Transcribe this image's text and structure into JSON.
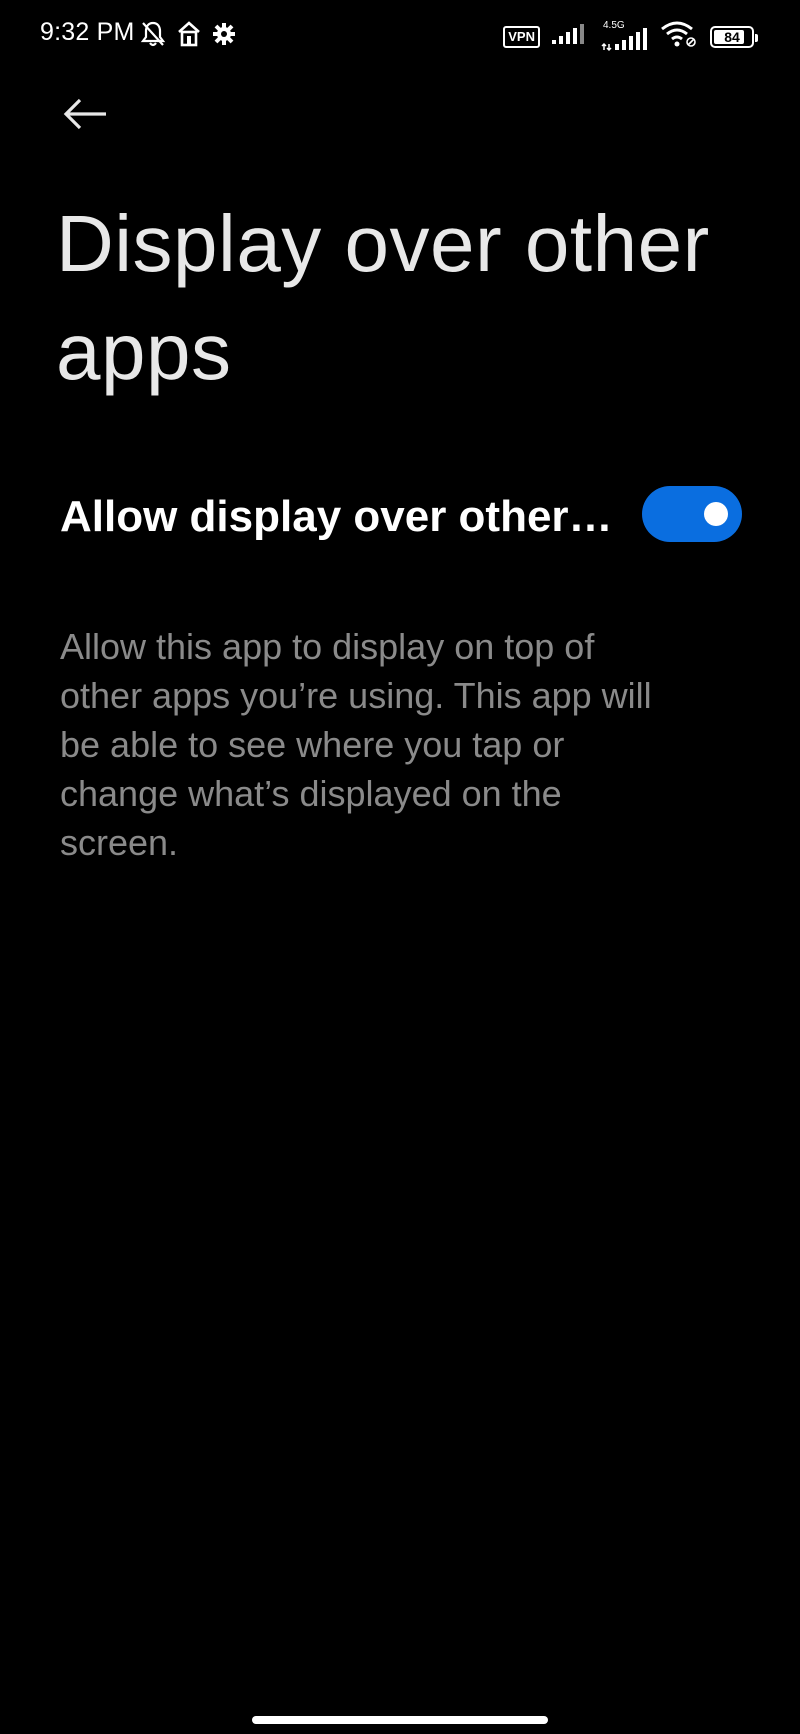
{
  "status_bar": {
    "time": "9:32 PM",
    "left_icons": [
      "bell-off-icon",
      "home-icon",
      "gear-icon"
    ],
    "vpn": "VPN",
    "network_type": "4.5G",
    "battery_level": "84",
    "battery_fraction": 0.84
  },
  "nav": {
    "back_icon": "back-arrow-icon"
  },
  "page": {
    "title": "Display over other apps",
    "toggle_label": "Allow display over other…",
    "toggle_on": true,
    "description": "Allow this app to display on top of other apps you’re using. This app will be able to see where you tap or change what’s displayed on the screen."
  },
  "colors": {
    "background": "#000000",
    "accent": "#0a6ee0",
    "title_text": "#e8e8e8",
    "secondary_text": "#8a8a8a"
  }
}
